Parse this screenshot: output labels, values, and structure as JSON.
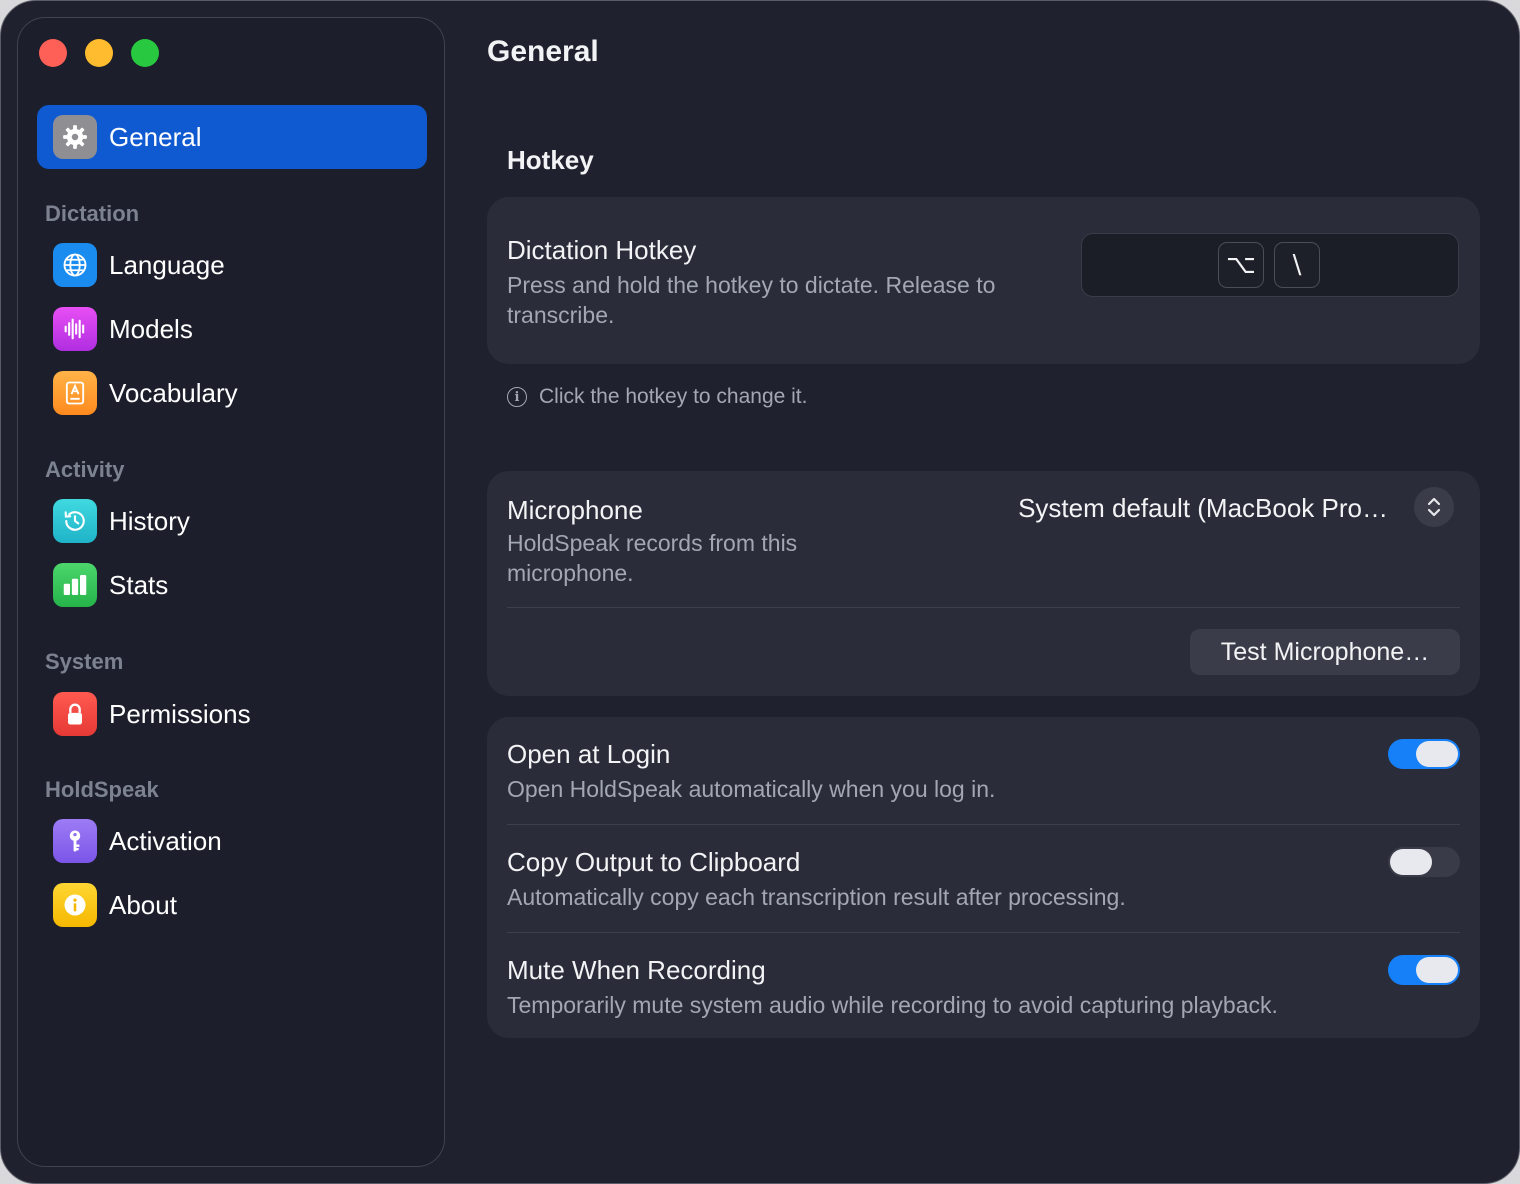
{
  "window": {
    "controls": [
      "close",
      "minimize",
      "zoom"
    ]
  },
  "sidebar": {
    "top_item": {
      "label": "General",
      "icon": "gear-icon",
      "icon_color": "#8e8e93",
      "active": true
    },
    "sections": [
      {
        "label": "Dictation",
        "items": [
          {
            "label": "Language",
            "icon": "globe-icon",
            "icon_color": "#1a8cf0"
          },
          {
            "label": "Models",
            "icon": "waveform-icon",
            "icon_color": "#d23cf0"
          },
          {
            "label": "Vocabulary",
            "icon": "book-icon",
            "icon_color": "#ff9a2e"
          }
        ]
      },
      {
        "label": "Activity",
        "items": [
          {
            "label": "History",
            "icon": "history-icon",
            "icon_color": "#2fc7d6"
          },
          {
            "label": "Stats",
            "icon": "chart-icon",
            "icon_color": "#30c15a"
          }
        ]
      },
      {
        "label": "System",
        "items": [
          {
            "label": "Permissions",
            "icon": "lock-icon",
            "icon_color": "#f0443e"
          }
        ]
      },
      {
        "label": "HoldSpeak",
        "items": [
          {
            "label": "Activation",
            "icon": "key-icon",
            "icon_color": "#8c6cf0"
          },
          {
            "label": "About",
            "icon": "info-icon",
            "icon_color": "#f5c518"
          }
        ]
      }
    ]
  },
  "main": {
    "title": "General",
    "hotkey_section": {
      "heading": "Hotkey",
      "title": "Dictation Hotkey",
      "description_line1": "Press and hold the hotkey to dictate. Release to",
      "description_line2": "transcribe.",
      "keys": [
        "⌥",
        "\\"
      ],
      "hint": "Click the hotkey to change it."
    },
    "microphone": {
      "title": "Microphone",
      "description_line1": "HoldSpeak records from this",
      "description_line2": "microphone.",
      "selected": "System default (MacBook Pro…",
      "test_button": "Test Microphone…"
    },
    "toggles": [
      {
        "title": "Open at Login",
        "description": "Open HoldSpeak automatically when you log in.",
        "on": true
      },
      {
        "title": "Copy Output to Clipboard",
        "description": "Automatically copy each transcription result after processing.",
        "on": false
      },
      {
        "title": "Mute When Recording",
        "description": "Temporarily mute system audio while recording to avoid capturing playback.",
        "on": true
      }
    ],
    "accent_color": "#1680f9"
  }
}
